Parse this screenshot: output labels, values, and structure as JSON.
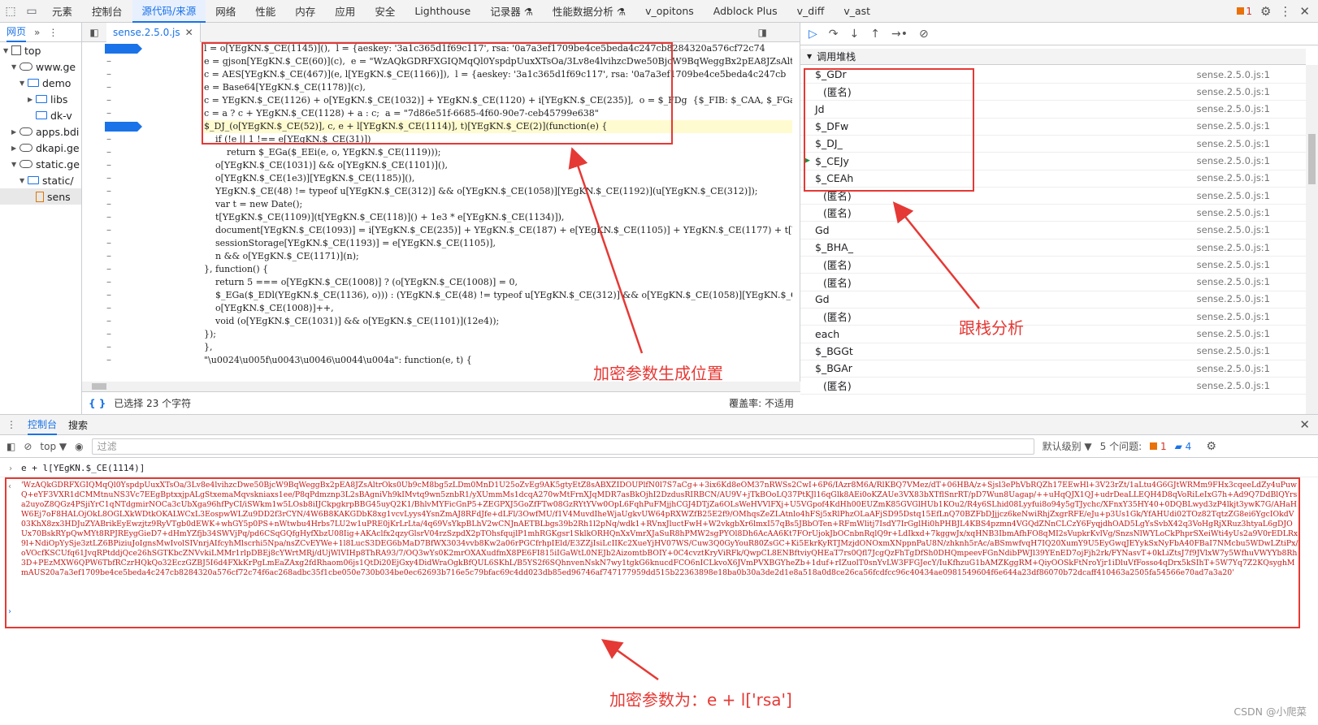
{
  "topbar": {
    "tabs": [
      "元素",
      "控制台",
      "源代码/来源",
      "网络",
      "性能",
      "内存",
      "应用",
      "安全",
      "Lighthouse",
      "记录器 ⚗",
      "性能数据分析 ⚗",
      "v_opitons",
      "Adblock Plus",
      "v_diff",
      "v_ast"
    ],
    "active_index": 2,
    "issues_count": "1"
  },
  "navigator": {
    "tab_label": "网页",
    "tree": [
      {
        "label": "top",
        "indent": 0,
        "icon": "page"
      },
      {
        "label": "www.ge",
        "indent": 1,
        "icon": "cloud"
      },
      {
        "label": "demo",
        "indent": 2,
        "icon": "folder"
      },
      {
        "label": "libs",
        "indent": 3,
        "icon": "folder"
      },
      {
        "label": "dk-v",
        "indent": 3,
        "icon": "folder"
      },
      {
        "label": "apps.bdi",
        "indent": 1,
        "icon": "cloud"
      },
      {
        "label": "dkapi.ge",
        "indent": 1,
        "icon": "cloud"
      },
      {
        "label": "static.ge",
        "indent": 1,
        "icon": "cloud"
      },
      {
        "label": "static/",
        "indent": 2,
        "icon": "folder"
      },
      {
        "label": "sens",
        "indent": 3,
        "icon": "file"
      }
    ]
  },
  "editor": {
    "file_tab": "sense.2.5.0.js",
    "status_left": "已选择 23 个字符",
    "status_right": "覆盖率: 不适用",
    "code_lines": [
      "l = o[YEgKN.$_CE(1145)](),  l = {aeskey: '3a1c365d1f69c117', rsa: '0a7a3ef1709be4ce5beda4c247cb8284320a576cf72c74",
      "e = gjson[YEgKN.$_CE(60)](c),  e = \"WzAQkGDRFXGIQMqQl0YspdpUuxXTsOa/3Lv8e4lvihzcDwe50BjcW9BqWeggBx2pEA8JZsAltrOks0Ub9c",
      "c = AES[YEgKN.$_CE(467)](e, l[YEgKN.$_CE(1166)]),  l = {aeskey: '3a1c365d1f69c117', rsa: '0a7a3ef1709be4ce5beda4c247cb",
      "e = Base64[YEgKN.$_CE(1178)](c),",
      "c = YEgKN.$_CE(1126) + o[YEgKN.$_CE(1032)] + YEgKN.$_CE(1120) + i[YEgKN.$_CE(235)],  o = $_FDg  {$_FIB: $_CAA, $_FGa:",
      "c = a ? c + YEgKN.$_CE(1128) + a : c;  a = \"7d86e51f-6685-4f60-90e7-ceb45799e638\"",
      "$_DJ_(o[YEgKN.$_CE(52)], c, e + l[YEgKN.$_CE(1114)], t)[YEgKN.$_CE(2)](function(e) {",
      "    if (!e || 1 !== e[YEgKN.$_CE(31)])",
      "        return $_EGa($_EEi(e, o, YEgKN.$_CE(1119)));",
      "    o[YEgKN.$_CE(1031)] && o[YEgKN.$_CE(1101)](),",
      "    o[YEgKN.$_CE(1e3)][YEgKN.$_CE(1185)](),",
      "    YEgKN.$_CE(48) != typeof u[YEgKN.$_CE(312)] && o[YEgKN.$_CE(1058)][YEgKN.$_CE(1192)](u[YEgKN.$_CE(312)]);",
      "    var t = new Date();",
      "    t[YEgKN.$_CE(1109)](t[YEgKN.$_CE(118)]() + 1e3 * e[YEgKN.$_CE(1134)]),",
      "    document[YEgKN.$_CE(1093)] = i[YEgKN.$_CE(235)] + YEgKN.$_CE(187) + e[YEgKN.$_CE(1105)] + YEgKN.$_CE(1177) + t[YEg",
      "    sessionStorage[YEgKN.$_CE(1193)] = e[YEgKN.$_CE(1105)],",
      "    n && o[YEgKN.$_CE(1171)](n);",
      "}, function() {",
      "    return 5 === o[YEgKN.$_CE(1008)] ? (o[YEgKN.$_CE(1008)] = 0,",
      "    $_EGa($_EDl(YEgKN.$_CE(1136), o))) : (YEgKN.$_CE(48) != typeof u[YEgKN.$_CE(312)] && o[YEgKN.$_CE(1058)][YEgKN.$_C",
      "    o[YEgKN.$_CE(1008)]++,",
      "    void (o[YEgKN.$_CE(1031)] && o[YEgKN.$_CE(1101)](12e4));",
      "});",
      "},",
      "\"\\u0024\\u005f\\u0043\\u0046\\u0044\\u004a\": function(e, t) {"
    ]
  },
  "call_stack": {
    "title": "调用堆栈",
    "frames": [
      {
        "name": "$_GDr",
        "loc": "sense.2.5.0.js:1",
        "anon": false
      },
      {
        "name": "(匿名)",
        "loc": "sense.2.5.0.js:1",
        "anon": true
      },
      {
        "name": "Jd",
        "loc": "sense.2.5.0.js:1",
        "anon": false
      },
      {
        "name": "$_DFw",
        "loc": "sense.2.5.0.js:1",
        "anon": false
      },
      {
        "name": "$_DJ_",
        "loc": "sense.2.5.0.js:1",
        "anon": false
      },
      {
        "name": "$_CEJy",
        "loc": "sense.2.5.0.js:1",
        "anon": false,
        "current": true
      },
      {
        "name": "$_CEAh",
        "loc": "sense.2.5.0.js:1",
        "anon": false
      },
      {
        "name": "(匿名)",
        "loc": "sense.2.5.0.js:1",
        "anon": true
      },
      {
        "name": "(匿名)",
        "loc": "sense.2.5.0.js:1",
        "anon": true
      },
      {
        "name": "Gd",
        "loc": "sense.2.5.0.js:1",
        "anon": false
      },
      {
        "name": "$_BHA_",
        "loc": "sense.2.5.0.js:1",
        "anon": false
      },
      {
        "name": "(匿名)",
        "loc": "sense.2.5.0.js:1",
        "anon": true
      },
      {
        "name": "(匿名)",
        "loc": "sense.2.5.0.js:1",
        "anon": true
      },
      {
        "name": "Gd",
        "loc": "sense.2.5.0.js:1",
        "anon": false
      },
      {
        "name": "(匿名)",
        "loc": "sense.2.5.0.js:1",
        "anon": true
      },
      {
        "name": "each",
        "loc": "sense.2.5.0.js:1",
        "anon": false
      },
      {
        "name": "$_BGGt",
        "loc": "sense.2.5.0.js:1",
        "anon": false
      },
      {
        "name": "$_BGAr",
        "loc": "sense.2.5.0.js:1",
        "anon": false
      },
      {
        "name": "(匿名)",
        "loc": "sense.2.5.0.js:1",
        "anon": true
      }
    ]
  },
  "drawer": {
    "tabs": [
      "控制台",
      "搜索"
    ],
    "context": "top ▼",
    "filter_placeholder": "过滤",
    "level": "默认级别 ▼",
    "issues_label": "5 个问题:",
    "issues_err": "1",
    "issues_info": "4",
    "command": "e + l[YEgKN.$_CE(1114)]",
    "result": "'WzAQkGDRFXGIQMqQl0YspdpUuxXTsOa/3Lv8e4lvihzcDwe50BjcW9BqWeggBx2pEA8JZsAltrOks0Ub9cM8bg5zLDm0MnD1U25oZvEg9AK5gtyEtZ8sABXZIDOUPlfN0l7S7aCg++3ix6Kd8eOM37nRWSs2CwI+6P6/IAzr8M6A/RlKBQ7VMez/dT+06HBA/z+Sjsl3ePhVbRQZh17EEwHl+3V23rZt/1aLtu4G6GJtWRMm9FHx3cqeeLdZy4uPuwQ+eYF3VXR1dCMMtnuNS3Vc7EEgBptxxjpALgStxemaMqvskniaxs1ee/P8qPdmznp3L2sBAgniVh9kIMvtq9wn5znbR1/yXUmmMs1dcqA270wMtFrnXJqMDR7asBkOjhI2DzdusRIRBCN/AU9V+jTkBOoLQ37PtKJl16qGlk8AEi0oKZAUe3VX83bXTflSnrRT/pD7Wun8Uagap/++uHqQJX1QJ+udrDeaLLEQH4D8qVoRiLeIxG7h+Ad9Q7DdBlQYrsa2uyoZ8QGz4PSjiYrC1qNTdgmirNOCa3cUbXga96hfPyCI/iSWkm1w5LOsb8iIJCkpgkrpBBG45uyQ2K1/BhlvMYFicGnP5+ZEGPXJ5GoZfFTw08GzRYtYVw0OpL6FqhPuFMjjhCGJ4DTjZa6OLsWeHVVlFXj+U5VGpof4KdHh00EUZmK85GVGlHUb1KOu2/R4y6SLhid08Lyyfui8o94y5gTJychc/XFnxY35HY40+0DQBLwyd3zP4lkjt3ywK7G/AHaHW6Ej7oF8HALOjOkL8OGLXkWDtkOKALWCxL3EospwWLZu9DD2f3rCYN/4W6B8KAKGDbK8xg1vcvLyys4YsnZmAJ8RFdJfe+dLFl/3OwfMU/f1V4MuvdIheWjaUgkvUW64pRXWZfB25E2f9/OMhqsZeZLAtnlo4hFSj5xRlPhzOLaAFjSD95Dstq15EfLnQ70BZFbDJjjcz6keNwiRhjZxgrRFE/eJu+p3Us1Gk/YfAHUdi02TOz82TqtzZG8ei6YgcIOkdV03KhX8zx3HDJuZYABrikEyEwzjtz9RyVTgb0dEWK+whGY5p0PS+nWtwbu4Hrbs7LU2w1uPRE0jKrLrLta/4q69VsYkpBLhV2wCNJnAETBLbgs39b2Rh1l2pNq/wdk1+RVnxJluctFwH+W2vkgbXr6lmxI57qBs5JBbOTen+RFmWlitj7IsdY7IrGglHi0hPHBJL4KBS4pzmn4VGQdZNnCLCzY6FyqjdhOAD5LgYsSvbX42q3VoHgRjXRuz3htyaL6gDJOUx70BskRYpQwMYt8RPJREygGieD7+dHmYZfjb34SWVjPq/pd6CSqGQfgHyfXbzU08Iig+AKAclfx2qzyGlsrV04rzSzpdX2pTOhsfqujlP1mhRGKgsr1SklkORHQnXxVmrXJaSuR8hPMW2sgPYOl8Dh6AcAA6Kt7FOrUjokJbOCnbnRqlQ9r+LdIkxd+7kggwJx/xqHNB3IbmAfhFO8qMI2sVupkrKvlVg/SnzsNlWYLoCkPhprSXeiWti4yUs2a9V0rEDLRx9l+NdiOpYySje3ztLZ6BPiziuJoIgnsMwIvolSIVnrjAIfcyhMlscrhi5Npa/nsZCvEYWe+1l8LucS3DEG6bMaD7BfWX3034vvb8Kw2a06rPGCfrhpIEld/E3ZZjIsiLcIIKc2XueYjHV07WS/Cuw3Q0GyYouR80ZsGC+Ki5EkrKyRTJMzjdONOxmXNppnPaU8N/zhknh5rAc/aBSmwfvqH7IQ20XumY9U5EyGwqJEYykSxNyFbA40FBaI7NMcbu5WDwLZtiPx/oVOcfKSCUfq61JvqRPtddjQce26hSGTKbcZNVvkiLMMr1rlpDBEj8cYWrtMRj/dUjWlVIHp8ThRA93/7/OQ3wYs0K2mrOXAXudfmX8PE6FI815iIGaWtL0NEJb2AizomtbBOIY+0C4cvztKryViRFk/QwpCL8ENBftviyQHEaT7rs0Qfl7JcgQzFhTgDfSh0DHQmpeevFGnNdibPWJl39YEnED7ojFjh2rk/FYNasvT+0kLiZtsJ7f9JVlxW7y5WfhuVWYYb8Rh3D+PEzMXW6QPW6TbfRCzrHQkQo32EczGZBJ5I6d4FXkKrPgLmEaZAxg2fdRhaom06js1QtDi20EjGxy4DidWraOgkBfQUL6SKhL/B5YS2f6SQhnvenNskN7wy1tgkG6knucdFCO6nICLkvoX6JVmPVXBGYheZb+1duf+rIZuolT0snYvLW3FFGJecY/IuKfhzuG1bAMZKggRM+QiyOOSkFtNroYjr1iDluVfFosso4qDrx5kSIhT+5W7Yq7Z2KQsyghMmAUS20a7a3ef1709be4ce5beda4c247cb8284320a576cf72c74f6ac268adbc35f1cbe050e730b034be0ec62693b716e5c79bfac69c4dd023db85ed96746af747177959dd515b22363898e18ba0b30a3de2d1e8a518a0d8ce26ca56fcdfcc96c40434ae0981549604f6e644a23df86070b72dcaff410463a2505fa54566e70ad7a3a20'"
  },
  "annotations": {
    "encrypt_location": "加密参数生成位置",
    "stack_analysis": "跟栈分析",
    "encrypt_param": "加密参数为：e + l['rsa']"
  },
  "watermark": "CSDN @小爬菜"
}
